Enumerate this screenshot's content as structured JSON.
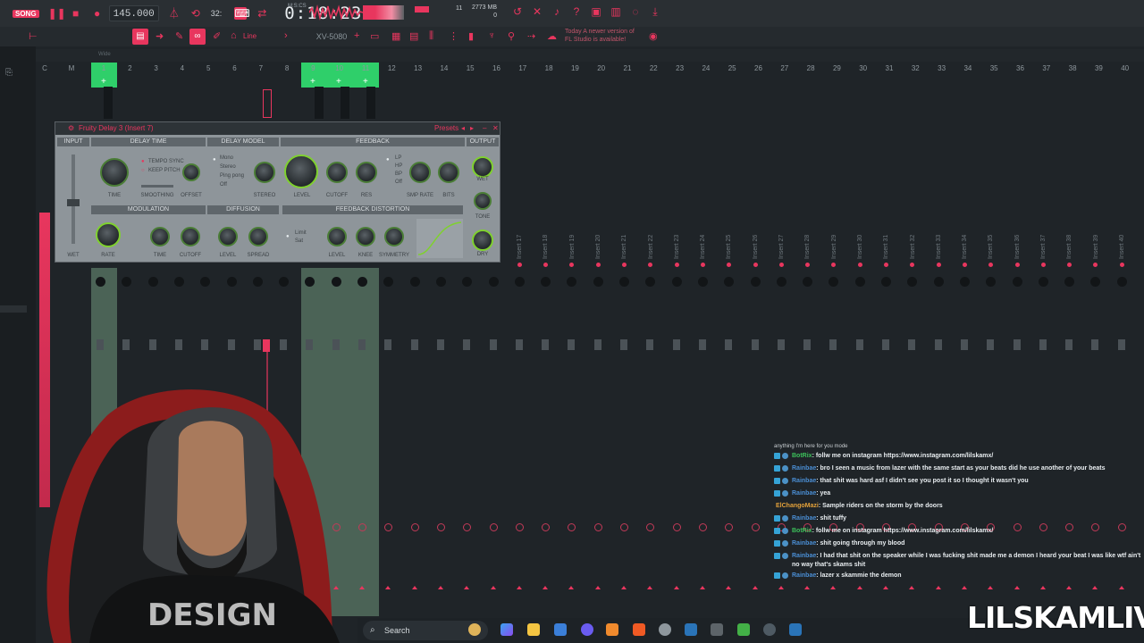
{
  "app": {
    "song_badge": "SONG",
    "tempo": "145.000",
    "step": "32:",
    "time": "0:18:23",
    "time_units": "M:S:CS",
    "cpu": "11",
    "ram_mb": "2773 MB",
    "ram_sub": "0",
    "pattern_mode": "Line",
    "instrument": "XV-5080",
    "news_line1": "Today  A newer version of",
    "news_line2": "FL Studio is available!",
    "accent": "#e8365e",
    "green": "#35c768"
  },
  "mixer": {
    "master_labels": [
      "C",
      "M"
    ],
    "track_numbers": [
      "1",
      "2",
      "3",
      "4",
      "5",
      "6",
      "7",
      "8",
      "9",
      "10",
      "11",
      "12",
      "13",
      "14",
      "15",
      "16",
      "17",
      "18",
      "19",
      "20",
      "21",
      "22",
      "23",
      "24",
      "25",
      "26",
      "27",
      "28",
      "29",
      "30",
      "31",
      "32",
      "33",
      "34",
      "35",
      "36",
      "37",
      "38",
      "39",
      "40"
    ],
    "insert_labels": [
      "Insert 17",
      "Insert 18",
      "Insert 19",
      "Insert 20",
      "Insert 21",
      "Insert 22",
      "Insert 23",
      "Insert 24",
      "Insert 25",
      "Insert 26",
      "Insert 27",
      "Insert 28",
      "Insert 29",
      "Insert 30",
      "Insert 31",
      "Insert 32",
      "Insert 33",
      "Insert 34",
      "Insert 35",
      "Insert 36",
      "Insert 37",
      "Insert 38",
      "Insert 39",
      "Insert 40"
    ],
    "wide_label": "Wide"
  },
  "plugin": {
    "title": "Fruity Delay 3 (Insert 7)",
    "presets": "Presets",
    "sections": {
      "input": "INPUT",
      "delay_time": "DELAY TIME",
      "delay_model": "DELAY MODEL",
      "feedback": "FEEDBACK",
      "output": "OUTPUT",
      "modulation": "MODULATION",
      "diffusion": "DIFFUSION",
      "feedback_distortion": "FEEDBACK DISTORTION"
    },
    "labels": {
      "tempo_sync": "TEMPO SYNC",
      "keep_pitch": "KEEP PITCH",
      "time": "TIME",
      "smoothing": "SMOOTHING",
      "offset": "OFFSET",
      "mono": "Mono",
      "stereo_opt": "Stereo",
      "ping_pong": "Ping pong",
      "off": "Off",
      "stereo": "STEREO",
      "level": "LEVEL",
      "cutoff": "CUTOFF",
      "res": "RES",
      "lp": "LP",
      "hp": "HP",
      "bp": "BP",
      "off2": "Off",
      "smp_rate": "SMP RATE",
      "bits": "BITS",
      "wet": "WET",
      "tone": "TONE",
      "dry": "DRY",
      "wet_input": "WET",
      "rate": "RATE",
      "mod_time": "TIME",
      "mod_cutoff": "CUTOFF",
      "diff_level": "LEVEL",
      "spread": "SPREAD",
      "limit": "Limit",
      "sat": "Sat",
      "dist_level": "LEVEL",
      "knee": "KNEE",
      "symmetry": "SYMMETRY"
    }
  },
  "chat": {
    "partial_top": "anything I'm here for you mode",
    "messages": [
      {
        "user": "BotRix",
        "user_color": "green",
        "text": ": follw me on instagram https://www.instagram.com/lilskamx/"
      },
      {
        "user": "Rainbae",
        "user_color": "blue",
        "text": ": bro I seen a music from lazer with the same start as your beats did he use another of your beats"
      },
      {
        "user": "Rainbae",
        "user_color": "blue",
        "text": ": that shit was hard asf I didn't see you post it so I thought it wasn't you"
      },
      {
        "user": "Rainbae",
        "user_color": "blue",
        "text": ": yea"
      },
      {
        "user": "ElChangoMazi",
        "user_color": "orange",
        "text": ": Sample riders on the storm by the doors"
      },
      {
        "user": "Rainbae",
        "user_color": "blue",
        "text": ": shit tuffy"
      },
      {
        "user": "BotRix",
        "user_color": "green",
        "text": ": follw me on instagram https://www.instagram.com/lilskamx/"
      },
      {
        "user": "Rainbae",
        "user_color": "blue",
        "text": ": shit going through my blood"
      },
      {
        "user": "Rainbae",
        "user_color": "blue",
        "text": ": I had that shit on the speaker while I was fucking shit made me a demon I heard your beat I was like wtf ain't no way that's skams shit"
      },
      {
        "user": "Rainbae",
        "user_color": "blue",
        "text": ": lazer x skammie the demon"
      }
    ]
  },
  "taskbar": {
    "search_placeholder": "Search"
  },
  "overlay": {
    "watermark": "LILSKAMLIVE"
  }
}
